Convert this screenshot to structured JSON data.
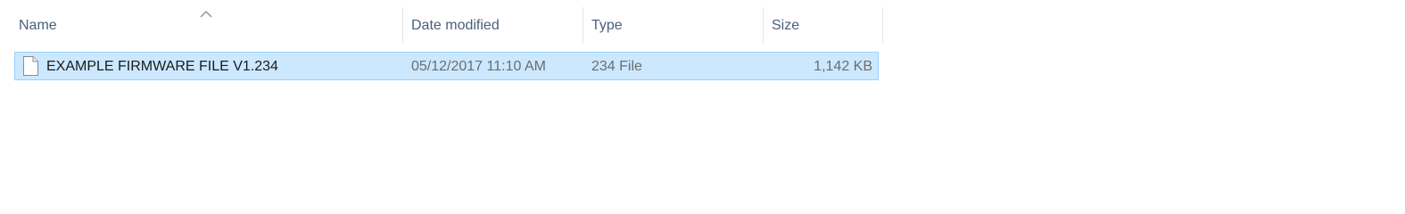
{
  "columns": {
    "name": "Name",
    "date_modified": "Date modified",
    "type": "Type",
    "size": "Size"
  },
  "sort": {
    "column": "name",
    "direction": "ascending",
    "indicator_icon": "chevron-up-icon"
  },
  "files": [
    {
      "icon": "document-icon",
      "name": "EXAMPLE FIRMWARE FILE V1.234",
      "date_modified": "05/12/2017 11:10 AM",
      "type": "234 File",
      "size": "1,142 KB",
      "selected": true
    }
  ],
  "colors": {
    "selection_fill": "#cce8ff",
    "selection_border": "#99d1ff",
    "header_text": "#4c607a",
    "secondary_text": "#6d6d6d",
    "primary_text": "#1a1a1a"
  }
}
